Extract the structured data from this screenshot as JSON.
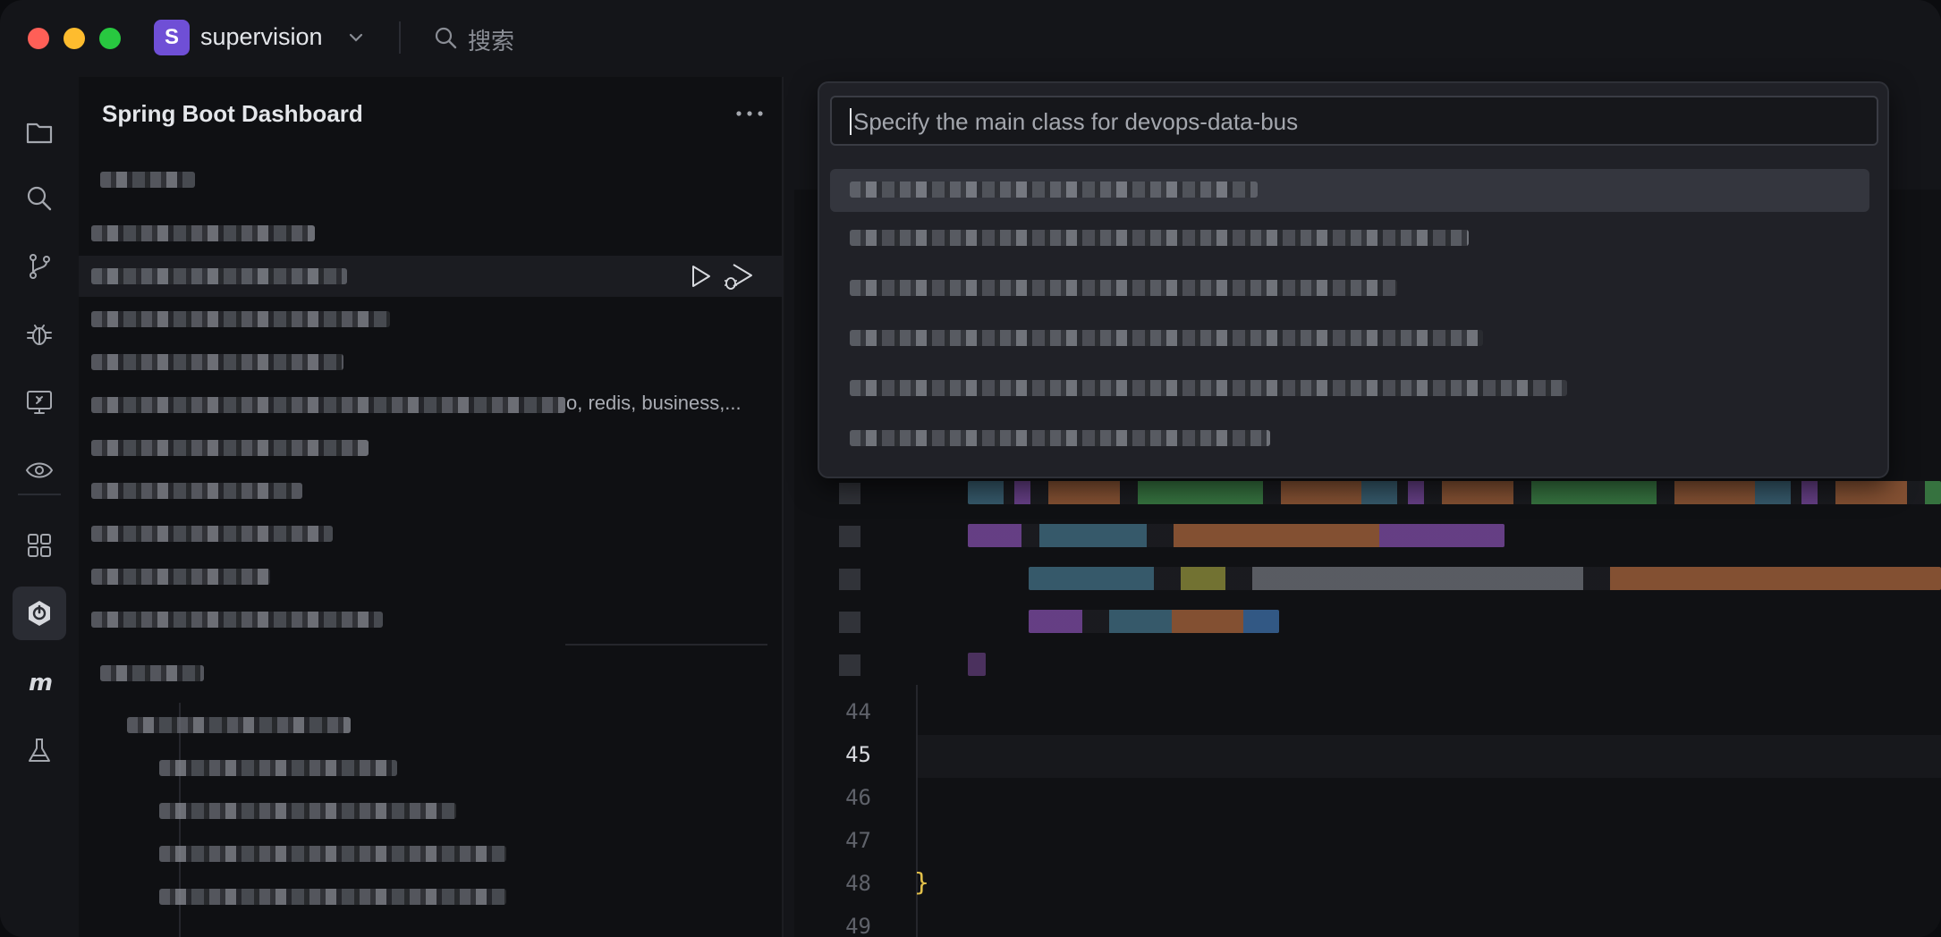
{
  "titlebar": {
    "project_badge": "S",
    "project_name": "supervision",
    "search_placeholder": "搜索"
  },
  "activity_bar": {
    "items": [
      {
        "icon": "files-icon"
      },
      {
        "icon": "search-icon"
      },
      {
        "icon": "source-control-icon"
      },
      {
        "icon": "debug-icon"
      },
      {
        "icon": "remote-explorer-icon"
      },
      {
        "icon": "watch-icon"
      },
      {
        "icon": "extensions-icon"
      },
      {
        "icon": "spring-boot-icon",
        "active": true
      },
      {
        "icon": "maven-icon"
      },
      {
        "icon": "testing-icon"
      }
    ]
  },
  "sidebar": {
    "title": "Spring Boot Dashboard",
    "row_description": "o, redis, business,..."
  },
  "editor": {
    "line_numbers": [
      "44",
      "45",
      "46",
      "47",
      "48",
      "49"
    ],
    "current_line": "45",
    "closing_brace": "}"
  },
  "quick_pick": {
    "placeholder": "Specify the main class for devops-data-bus"
  },
  "colors": {
    "accent": "#6f4fd6",
    "background": "#141519",
    "sidebar_bg": "#0f1013",
    "brace": "#e2c04a"
  }
}
